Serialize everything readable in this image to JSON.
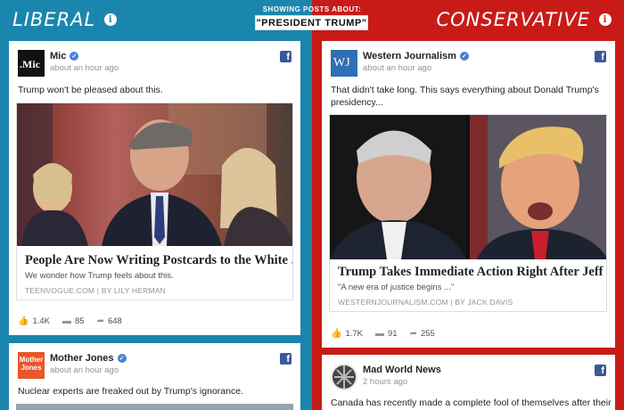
{
  "header": {
    "left_label": "LIBERAL",
    "right_label": "CONSERVATIVE",
    "topic_caption": "SHOWING POSTS ABOUT:",
    "topic": "\"PRESIDENT TRUMP\""
  },
  "colors": {
    "liberal": "#1b86ad",
    "conservative": "#c81b17"
  },
  "liberal_posts": [
    {
      "source": "Mic",
      "avatar_text": ".Mic",
      "time": "about an hour ago",
      "text": "Trump won't be pleased about this.",
      "link_title": "People Are Now Writing Postcards to the White ...",
      "link_desc": "We wonder how Trump feels about this.",
      "link_domain": "TEENVOGUE.COM | BY LILY HERMAN",
      "likes": "1.4K",
      "comments": "85",
      "shares": "648"
    },
    {
      "source": "Mother Jones",
      "avatar_text": "Mother Jones",
      "time": "about an hour ago",
      "text": "Nuclear experts are freaked out by Trump's ignorance."
    }
  ],
  "conservative_posts": [
    {
      "source": "Western Journalism",
      "avatar_text": "WJ",
      "time": "about an hour ago",
      "text": "That didn't take long. This says everything about Donald Trump's presidency...",
      "link_title": "Trump Takes Immediate Action Right After Jeff ...",
      "link_desc": "\"A new era of justice begins ...\"",
      "link_domain": "WESTERNJOURNALISM.COM | BY JACK DAVIS",
      "likes": "1.7K",
      "comments": "91",
      "shares": "255"
    },
    {
      "source": "Mad World News",
      "time": "2 hours ago",
      "text": "Canada has recently made a complete fool of themselves after their"
    }
  ],
  "icons": {
    "info": "info-icon",
    "facebook": "facebook-icon",
    "verified": "verified-icon",
    "like": "like-icon",
    "comment": "comment-icon",
    "share": "share-icon"
  }
}
